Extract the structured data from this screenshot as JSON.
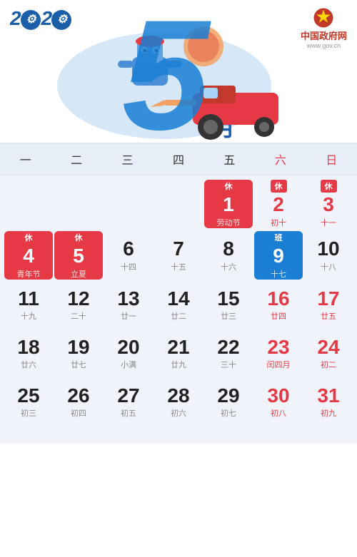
{
  "header": {
    "year": "2020",
    "month_number": "5",
    "month_char": "月",
    "gov_name": "中国政府网",
    "gov_url": "www.gov.cn"
  },
  "weekdays": [
    {
      "label": "一",
      "type": "normal"
    },
    {
      "label": "二",
      "type": "normal"
    },
    {
      "label": "三",
      "type": "normal"
    },
    {
      "label": "四",
      "type": "normal"
    },
    {
      "label": "五",
      "type": "normal"
    },
    {
      "label": "六",
      "type": "saturday"
    },
    {
      "label": "日",
      "type": "sunday"
    }
  ],
  "days": [
    {
      "num": "",
      "sub": "",
      "badge": "",
      "style": "empty"
    },
    {
      "num": "",
      "sub": "",
      "badge": "",
      "style": "empty"
    },
    {
      "num": "",
      "sub": "",
      "badge": "",
      "style": "empty"
    },
    {
      "num": "",
      "sub": "",
      "badge": "",
      "style": "empty"
    },
    {
      "num": "1",
      "sub": "劳动节",
      "badge": "休",
      "style": "red-highlight"
    },
    {
      "num": "2",
      "sub": "初十",
      "badge": "休",
      "style": "normal-red"
    },
    {
      "num": "3",
      "sub": "十一",
      "badge": "休",
      "style": "normal-red"
    },
    {
      "num": "4",
      "sub": "青年节",
      "badge": "休",
      "style": "red-highlight"
    },
    {
      "num": "5",
      "sub": "立夏",
      "badge": "休",
      "style": "red-highlight"
    },
    {
      "num": "6",
      "sub": "十四",
      "badge": "",
      "style": "normal"
    },
    {
      "num": "7",
      "sub": "十五",
      "badge": "",
      "style": "normal"
    },
    {
      "num": "8",
      "sub": "十六",
      "badge": "",
      "style": "normal"
    },
    {
      "num": "9",
      "sub": "十七",
      "badge": "班",
      "style": "blue-highlight"
    },
    {
      "num": "10",
      "sub": "十八",
      "badge": "",
      "style": "normal"
    },
    {
      "num": "11",
      "sub": "十九",
      "badge": "",
      "style": "normal"
    },
    {
      "num": "12",
      "sub": "二十",
      "badge": "",
      "style": "normal"
    },
    {
      "num": "13",
      "sub": "廿一",
      "badge": "",
      "style": "normal"
    },
    {
      "num": "14",
      "sub": "廿二",
      "badge": "",
      "style": "normal"
    },
    {
      "num": "15",
      "sub": "廿三",
      "badge": "",
      "style": "normal"
    },
    {
      "num": "16",
      "sub": "廿四",
      "badge": "",
      "style": "sat"
    },
    {
      "num": "17",
      "sub": "廿五",
      "badge": "",
      "style": "sun"
    },
    {
      "num": "18",
      "sub": "廿六",
      "badge": "",
      "style": "normal"
    },
    {
      "num": "19",
      "sub": "廿七",
      "badge": "",
      "style": "normal"
    },
    {
      "num": "20",
      "sub": "小满",
      "badge": "",
      "style": "normal"
    },
    {
      "num": "21",
      "sub": "廿九",
      "badge": "",
      "style": "normal"
    },
    {
      "num": "22",
      "sub": "三十",
      "badge": "",
      "style": "normal"
    },
    {
      "num": "23",
      "sub": "闰四月",
      "badge": "",
      "style": "sat"
    },
    {
      "num": "24",
      "sub": "初二",
      "badge": "",
      "style": "sun"
    },
    {
      "num": "25",
      "sub": "初三",
      "badge": "",
      "style": "normal"
    },
    {
      "num": "26",
      "sub": "初四",
      "badge": "",
      "style": "normal"
    },
    {
      "num": "27",
      "sub": "初五",
      "badge": "",
      "style": "normal"
    },
    {
      "num": "28",
      "sub": "初六",
      "badge": "",
      "style": "normal"
    },
    {
      "num": "29",
      "sub": "初七",
      "badge": "",
      "style": "normal"
    },
    {
      "num": "30",
      "sub": "初八",
      "badge": "",
      "style": "sat"
    },
    {
      "num": "31",
      "sub": "初九",
      "badge": "",
      "style": "sun"
    }
  ]
}
